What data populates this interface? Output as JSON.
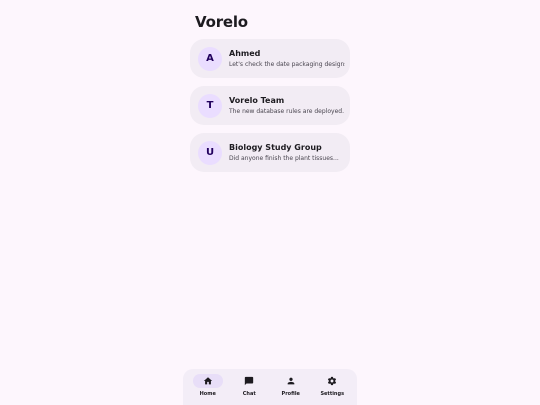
{
  "app": {
    "title": "Vorelo"
  },
  "chats": [
    {
      "initial": "A",
      "name": "Ahmed",
      "preview": "Let's check the date packaging designs..."
    },
    {
      "initial": "T",
      "name": "Vorelo Team",
      "preview": "The new database rules are deployed."
    },
    {
      "initial": "U",
      "name": "Biology Study Group",
      "preview": "Did anyone finish the plant tissues..."
    }
  ],
  "nav": {
    "items": [
      {
        "label": "Home",
        "icon": "home-icon",
        "active": true
      },
      {
        "label": "Chat",
        "icon": "chat-icon",
        "active": false
      },
      {
        "label": "Profile",
        "icon": "person-icon",
        "active": false
      },
      {
        "label": "Settings",
        "icon": "gear-icon",
        "active": false
      }
    ]
  },
  "colors": {
    "background": "#fdf6fd",
    "card": "#f2ecf4",
    "avatar": "#eaddff",
    "nav_active": "#e8def8"
  }
}
